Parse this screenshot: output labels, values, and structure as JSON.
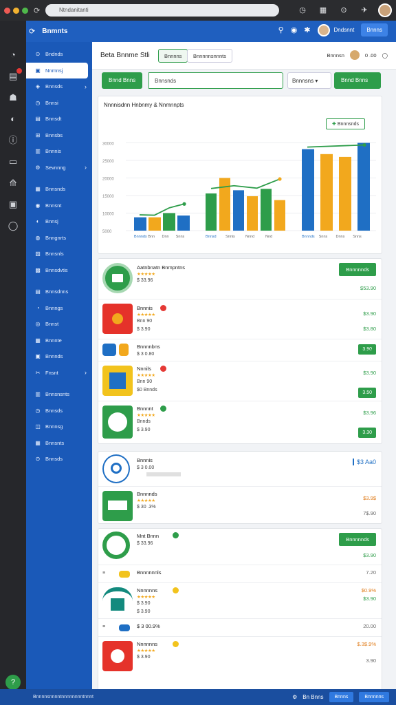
{
  "browser": {
    "address": "Ntndanitanti"
  },
  "topbar": {
    "brand": "Bnmnts",
    "user_name": "Dndsnnt",
    "action": "Bnnns"
  },
  "sidebar": {
    "items": [
      {
        "label": "Bndnds",
        "chev": false
      },
      {
        "label": "Nnmnsj",
        "chev": false,
        "active": true
      },
      {
        "label": "Bnnsds",
        "chev": true
      },
      {
        "label": "Bnnsi",
        "chev": false
      },
      {
        "label": "Bnnsdt",
        "chev": false
      },
      {
        "label": "Bnnsbs",
        "chev": false
      },
      {
        "label": "Bnnnis",
        "chev": false
      },
      {
        "label": "Sevnnng",
        "chev": true
      },
      {
        "gap": true
      },
      {
        "label": "Bnnsnds",
        "chev": false
      },
      {
        "label": "Bnnsnt",
        "chev": false
      },
      {
        "label": "Bnnsj",
        "chev": false
      },
      {
        "label": "Bnngnrts",
        "chev": false
      },
      {
        "label": "Bnnsnls",
        "chev": false
      },
      {
        "label": "Bnnsdvtis",
        "chev": false
      },
      {
        "gap": true
      },
      {
        "label": "Bnnsdnns",
        "chev": false
      },
      {
        "label": "Bnnngs",
        "chev": false
      },
      {
        "label": "Bnnst",
        "chev": false
      },
      {
        "label": "Bnnnte",
        "chev": false
      },
      {
        "label": "Bnnnds",
        "chev": false
      },
      {
        "label": "Fnsnt",
        "chev": true
      },
      {
        "gap": true
      },
      {
        "label": "Bnnsnsnts",
        "chev": false
      },
      {
        "label": "Bnnsds",
        "chev": false
      },
      {
        "label": "Bnnnsg",
        "chev": false
      },
      {
        "label": "Bnnsnts",
        "chev": false
      },
      {
        "label": "Bnnsds",
        "chev": false
      }
    ]
  },
  "header": {
    "title": "Beta Bnnme Stli",
    "tab1": "Bnnnns",
    "tab2": "Bnnnnnsnnnts",
    "user": "Bnnnsn",
    "count": "0 .00"
  },
  "filter": {
    "button": "Bnnd Bnns",
    "search": "Bnnsnds",
    "select": "Bnnnsns",
    "action": "Bnnd Bnns"
  },
  "chart_data": {
    "type": "bar",
    "title": "Nnnnisdnn Hnbnmy & Nnmnnpts",
    "ylim": [
      0,
      30000
    ],
    "yticks": [
      "0",
      "5000",
      "10000",
      "15000",
      "20000",
      "25000",
      "30000"
    ],
    "yticklabels": [
      "",
      "5000",
      "10000",
      "15000",
      "20000",
      "25000",
      "30000"
    ],
    "groups": [
      {
        "labels": [
          "Bnnnds",
          "Bnn",
          "Dnn",
          "Snns"
        ],
        "values": [
          3800,
          3800,
          5000,
          4300
        ],
        "colors": [
          "#1f6fc4",
          "#f2a81d",
          "#2e9d4a",
          "#1f6fc4"
        ],
        "trend": [
          4500,
          4400,
          6500,
          7600
        ]
      },
      {
        "labels": [
          "Bnnsd",
          "Snnis",
          "Nnnd",
          "Nnd"
        ],
        "values": [
          10600,
          15000,
          11500,
          9800,
          11900,
          8700
        ],
        "colors": [
          "#2e9d4a",
          "#f2a81d",
          "#1f6fc4",
          "#f2a81d",
          "#2e9d4a",
          "#f2a81d"
        ],
        "trend": [
          12000,
          12800,
          12100,
          14700
        ]
      },
      {
        "labels": [
          "Bnnnds",
          "Snns",
          "Dnns",
          "Snns"
        ],
        "values": [
          23200,
          21800,
          21000,
          25000
        ],
        "colors": [
          "#1f6fc4",
          "#f2a81d",
          "#f2a81d",
          "#1f6fc4"
        ],
        "trend": [
          23800,
          24400
        ]
      }
    ],
    "button": "Bnnnsnds"
  },
  "list1": {
    "button": "Bnnnnnds",
    "rows": [
      {
        "name": "Aatnbnatn Bnmpntns",
        "price": "$53.90",
        "sub": "$ 33.96",
        "stars": "★★★★★"
      },
      {
        "name": "Bnnnis",
        "price": "$3.90",
        "sub": "Bnn 90",
        "stars": "★★★★★",
        "sub2": "$ 3.90",
        "price2": "$3.80"
      },
      {
        "name": "Bnnnnbns",
        "price": "3.90",
        "sub": "$ 3 0.80"
      },
      {
        "name": "Nnnils",
        "price": "$3.90",
        "sub": "Bnn 90",
        "stars": "★★★★★",
        "sub2": "$0 Bnnds",
        "price2": "3.50"
      },
      {
        "name": "Bnnnnt",
        "price": "$3.96",
        "sub": "Bnnds",
        "stars": "★★★★★",
        "sub2": "$ 3.90",
        "price2": "3.30"
      }
    ]
  },
  "list2": {
    "label": "$3 Aa0",
    "rows": [
      {
        "name": "Bnnnis",
        "sub": "$ 3 0.00",
        "price": ""
      },
      {
        "name": "Bnnnnds",
        "price": "$3.9$",
        "sub": "$ 30 .3%",
        "stars": "★★★★★",
        "price2": "7$.90"
      }
    ]
  },
  "list3": {
    "button": "Bnnnnnds",
    "rows": [
      {
        "name": "Mnt Bnnn",
        "price": "$3.90",
        "sub": "$ 33.96"
      },
      {
        "name": "Bnnnnnnls",
        "price": "7.20"
      },
      {
        "name": "Nnnnnns",
        "price": "$0.9%",
        "sub": "$ 3.90",
        "stars": "★★★★★",
        "sub2": "$ 3.90",
        "price2": "$3.90"
      },
      {
        "name": "$ 3 00.9%",
        "price": "20.00"
      },
      {
        "name": "Nnnnnns",
        "price": "$.3$.9%",
        "stars": "★★★★★",
        "sub": "$ 3.90",
        "price2": "3.90"
      }
    ]
  },
  "footer": {
    "text": "Bnnnnsnnnntnnnnnnnntnnnt",
    "link": "Bn Bnns",
    "b1": "Bnnns",
    "b2": "Bnnnnns"
  }
}
